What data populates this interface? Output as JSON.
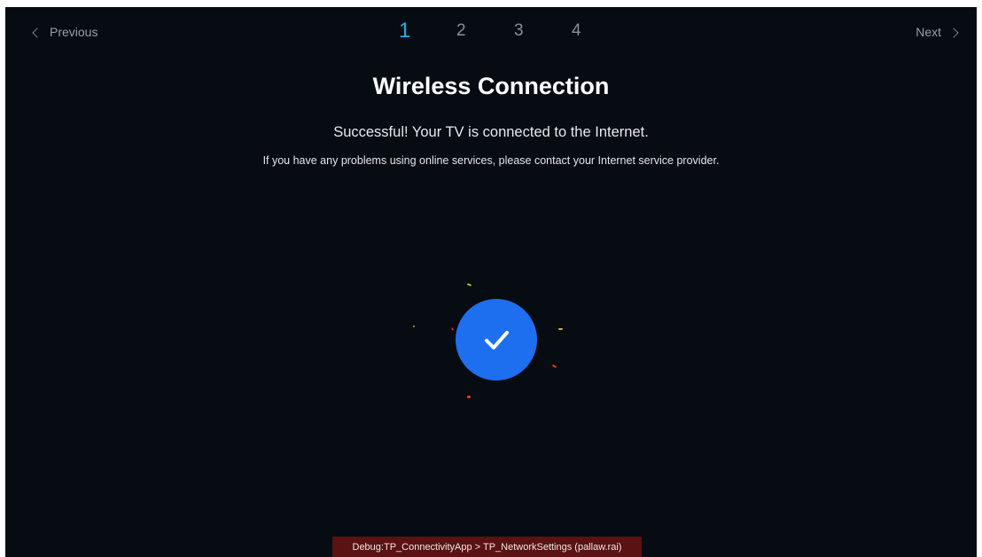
{
  "nav": {
    "previous_label": "Previous",
    "next_label": "Next"
  },
  "steps": {
    "items": [
      "1",
      "2",
      "3",
      "4"
    ],
    "active_index": 0
  },
  "page": {
    "title": "Wireless Connection",
    "subtitle": "Successful! Your TV is connected to the Internet.",
    "message": "If you have any problems using online services, please contact your Internet service provider."
  },
  "status": {
    "icon": "checkmark-icon",
    "state": "success"
  },
  "debug": {
    "text": "Debug:TP_ConnectivityApp > TP_NetworkSettings (pallaw.rai)"
  },
  "colors": {
    "background": "#070b12",
    "accent": "#29a8e6",
    "success_circle": "#1e6ef0",
    "debug_bar": "#5a1212"
  }
}
